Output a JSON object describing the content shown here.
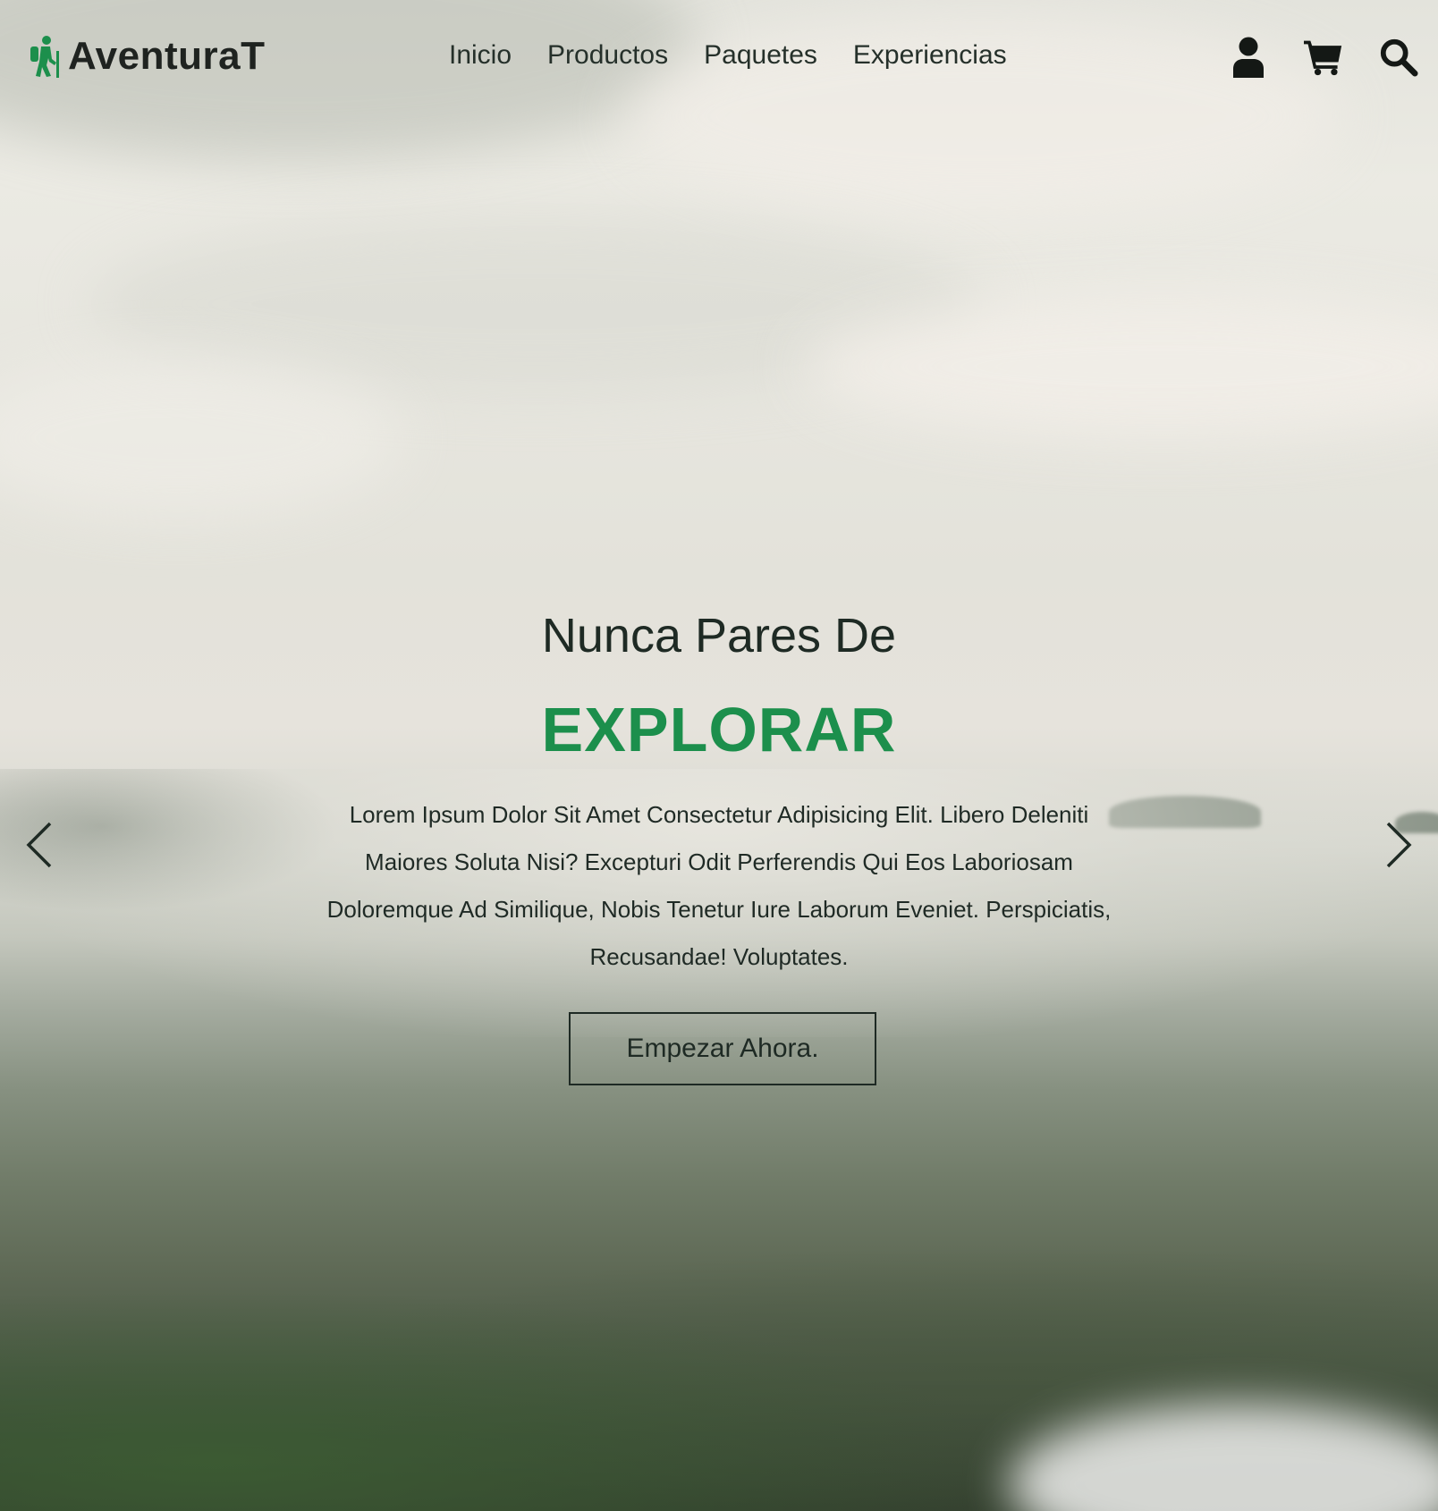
{
  "brand": {
    "name": "AventuraT",
    "accent_color": "#1c8f4c",
    "logo_icon": "hiker-icon"
  },
  "nav": {
    "items": [
      {
        "label": "Inicio"
      },
      {
        "label": "Productos"
      },
      {
        "label": "Paquetes"
      },
      {
        "label": "Experiencias"
      }
    ]
  },
  "header_icons": [
    "user-icon",
    "cart-icon",
    "search-icon"
  ],
  "hero": {
    "subtitle": "Nunca Pares De",
    "title": "EXPLORAR",
    "description": "Lorem Ipsum Dolor Sit Amet Consectetur Adipisicing Elit. Libero Deleniti Maiores Soluta Nisi? Excepturi Odit Perferendis Qui Eos Laboriosam Doloremque Ad Similique, Nobis Tenetur Iure Laborum Eveniet. Perspiciatis, Recusandae! Voluptates.",
    "cta_label": "Empezar Ahora."
  },
  "carousel": {
    "prev_icon": "chevron-left-icon",
    "next_icon": "chevron-right-icon"
  }
}
